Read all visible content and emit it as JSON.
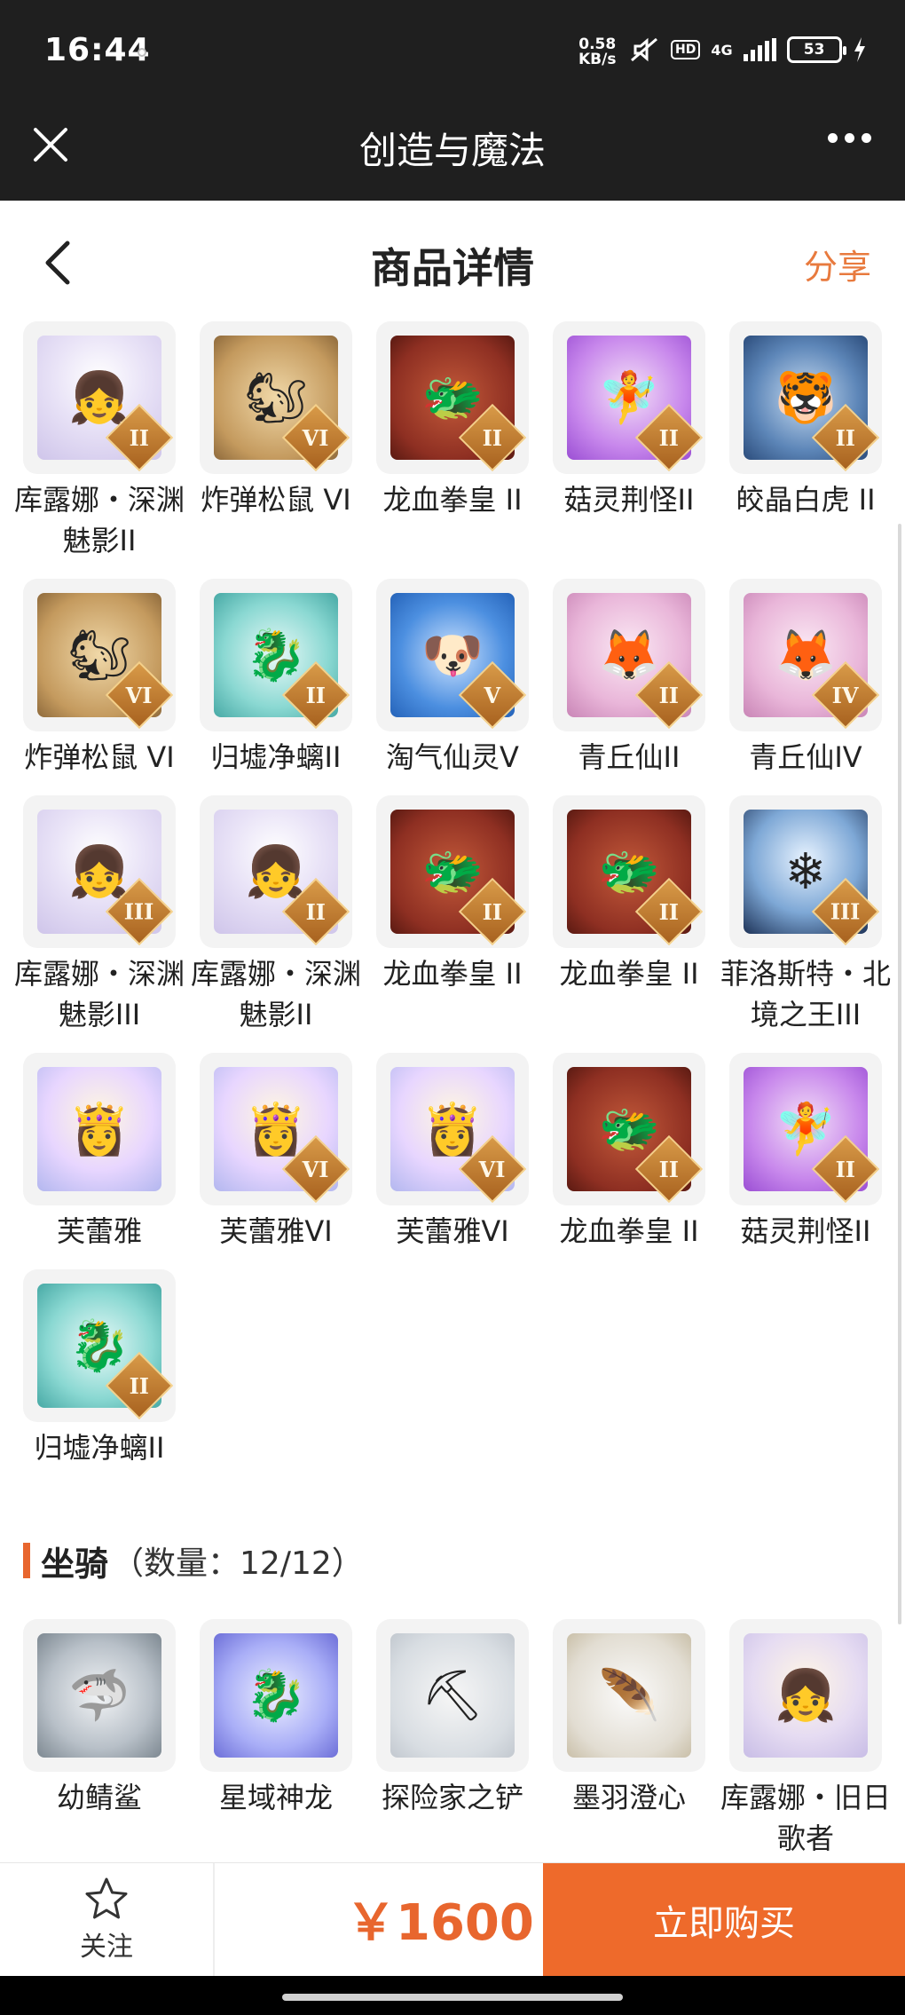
{
  "status_bar": {
    "time": "16:44",
    "net_speed_value": "0.58",
    "net_speed_unit": "KB/s",
    "hd_label": "HD",
    "signal_label": "4G",
    "battery_level": "53"
  },
  "app_bar": {
    "title": "创造与魔法"
  },
  "page_header": {
    "title": "商品详情",
    "share_label": "分享"
  },
  "items": [
    {
      "name": "库露娜・深渊魅影II",
      "badge": "II",
      "icon": "ghost-girl-icon",
      "palette": "ghost",
      "emoji": "👧"
    },
    {
      "name": "炸弹松鼠 VI",
      "badge": "VI",
      "icon": "squirrel-icon",
      "palette": "squirrel",
      "emoji": "🐿"
    },
    {
      "name": "龙血拳皇 II",
      "badge": "II",
      "icon": "dragon-beast-icon",
      "palette": "dragon",
      "emoji": "🐲"
    },
    {
      "name": "菇灵荆怪II",
      "badge": "II",
      "icon": "mushroom-sprite-icon",
      "palette": "purple",
      "emoji": "🧚"
    },
    {
      "name": "皎晶白虎 II",
      "badge": "II",
      "icon": "white-tiger-icon",
      "palette": "tiger",
      "emoji": "🐯"
    },
    {
      "name": "炸弹松鼠 VI",
      "badge": "VI",
      "icon": "squirrel-icon",
      "palette": "squirrel",
      "emoji": "🐿"
    },
    {
      "name": "归墟净螭II",
      "badge": "II",
      "icon": "cyan-dragon-icon",
      "palette": "cyan",
      "emoji": "🐉"
    },
    {
      "name": "淘气仙灵V",
      "badge": "V",
      "icon": "blue-pup-icon",
      "palette": "blue",
      "emoji": "🐶"
    },
    {
      "name": "青丘仙II",
      "badge": "II",
      "icon": "fox-fairy-icon",
      "palette": "pink",
      "emoji": "🦊"
    },
    {
      "name": "青丘仙IV",
      "badge": "IV",
      "icon": "fox-fairy-icon",
      "palette": "pink",
      "emoji": "🦊"
    },
    {
      "name": "库露娜・深渊魅影III",
      "badge": "III",
      "icon": "ghost-girl-icon",
      "palette": "ghost",
      "emoji": "👧"
    },
    {
      "name": "库露娜・深渊魅影II",
      "badge": "II",
      "icon": "ghost-girl-icon",
      "palette": "ghost",
      "emoji": "👧"
    },
    {
      "name": "龙血拳皇 II",
      "badge": "II",
      "icon": "dragon-beast-icon",
      "palette": "dragon",
      "emoji": "🐲"
    },
    {
      "name": "龙血拳皇 II",
      "badge": "II",
      "icon": "dragon-beast-icon",
      "palette": "dragon",
      "emoji": "🐲"
    },
    {
      "name": "菲洛斯特・北境之王III",
      "badge": "III",
      "icon": "frost-king-icon",
      "palette": "ice",
      "emoji": "❄"
    },
    {
      "name": "芙蕾雅",
      "badge": "",
      "icon": "valkyrie-icon",
      "palette": "gold",
      "emoji": "👸"
    },
    {
      "name": "芙蕾雅VI",
      "badge": "VI",
      "icon": "valkyrie-icon",
      "palette": "gold",
      "emoji": "👸"
    },
    {
      "name": "芙蕾雅VI",
      "badge": "VI",
      "icon": "valkyrie-icon",
      "palette": "gold",
      "emoji": "👸"
    },
    {
      "name": "龙血拳皇 II",
      "badge": "II",
      "icon": "dragon-beast-icon",
      "palette": "dragon",
      "emoji": "🐲"
    },
    {
      "name": "菇灵荆怪II",
      "badge": "II",
      "icon": "mushroom-sprite-icon",
      "palette": "purple",
      "emoji": "🧚"
    },
    {
      "name": "归墟净螭II",
      "badge": "II",
      "icon": "cyan-dragon-icon",
      "palette": "cyan",
      "emoji": "🐉"
    }
  ],
  "mounts_section": {
    "title": "坐骑",
    "count_label": "（数量：12/12）"
  },
  "mounts": [
    {
      "name": "幼鲭鲨",
      "icon": "shark-icon",
      "palette": "shark",
      "emoji": "🦈"
    },
    {
      "name": "星域神龙",
      "icon": "star-dragon-icon",
      "palette": "star",
      "emoji": "🐉"
    },
    {
      "name": "探险家之铲",
      "icon": "shovel-icon",
      "palette": "shovel",
      "emoji": "⛏"
    },
    {
      "name": "墨羽澄心",
      "icon": "feather-staff-icon",
      "palette": "feather",
      "emoji": "🪶"
    },
    {
      "name": "库露娜・旧日歌者",
      "icon": "singer-girl-icon",
      "palette": "singer",
      "emoji": "👧"
    }
  ],
  "bottom_bar": {
    "follow_label": "关注",
    "price": "￥1600",
    "buy_label": "立即购买"
  },
  "colors": {
    "accent": "#ee6a2b",
    "price": "#e8662e",
    "share": "#e87a3e",
    "topbar": "#1f1f1f"
  }
}
